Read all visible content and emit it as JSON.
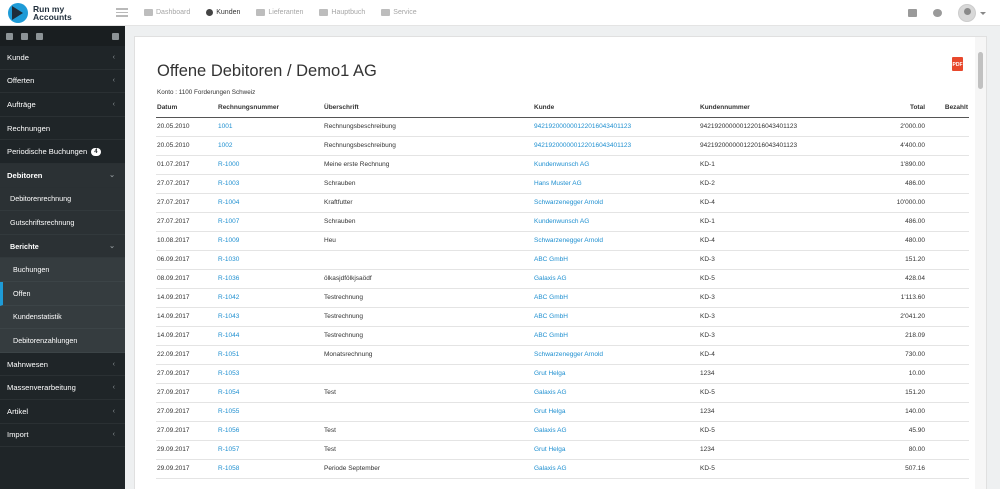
{
  "app": {
    "logo_line1": "Run my",
    "logo_line2": "Accounts"
  },
  "nav": [
    {
      "label": "Dashboard",
      "icon": "dashboard-icon",
      "active": false
    },
    {
      "label": "Kunden",
      "icon": "users-icon",
      "active": true
    },
    {
      "label": "Lieferanten",
      "icon": "truck-icon",
      "active": false
    },
    {
      "label": "Hauptbuch",
      "icon": "book-icon",
      "active": false
    },
    {
      "label": "Service",
      "icon": "service-icon",
      "active": false
    }
  ],
  "sidebar": {
    "items": [
      {
        "label": "Kunde",
        "chevron": "‹"
      },
      {
        "label": "Offerten",
        "chevron": "‹"
      },
      {
        "label": "Aufträge",
        "chevron": "‹"
      },
      {
        "label": "Rechnungen",
        "chevron": ""
      },
      {
        "label": "Periodische Buchungen",
        "chevron": "",
        "badge": "4"
      },
      {
        "label": "Debitoren",
        "chevron": "⌄"
      }
    ],
    "debitoren_sub": [
      {
        "label": "Debitorenrechnung"
      },
      {
        "label": "Gutschriftsrechnung"
      },
      {
        "label": "Berichte",
        "chevron": "⌄"
      }
    ],
    "berichte_sub": [
      {
        "label": "Buchungen"
      },
      {
        "label": "Offen"
      },
      {
        "label": "Kundenstatistik"
      },
      {
        "label": "Debitorenzahlungen"
      }
    ],
    "bottom": [
      {
        "label": "Mahnwesen",
        "chevron": "‹"
      },
      {
        "label": "Massenverarbeitung",
        "chevron": "‹"
      },
      {
        "label": "Artikel",
        "chevron": "‹"
      },
      {
        "label": "Import",
        "chevron": "‹"
      }
    ]
  },
  "report": {
    "title": "Offene Debitoren / Demo1 AG",
    "konto": "Konto : 1100 Forderungen Schweiz",
    "pdf_label": "PDF",
    "columns": [
      "Datum",
      "Rechnungsnummer",
      "Überschrift",
      "Kunde",
      "Kundennummer",
      "Total",
      "Bezahlt"
    ],
    "rows": [
      [
        "20.05.2010",
        "1001",
        "Rechnungsbeschreibung",
        "94219200000012201604340​1123",
        "942192000000122016043401123",
        "2'000.00",
        ""
      ],
      [
        "20.05.2010",
        "1002",
        "Rechnungsbeschreibung",
        "942192000000122016043401123",
        "942192000000122016043401123",
        "4'400.00",
        ""
      ],
      [
        "01.07.2017",
        "R-1000",
        "Meine erste Rechnung",
        "Kundenwunsch AG",
        "KD-1",
        "1'890.00",
        ""
      ],
      [
        "27.07.2017",
        "R-1003",
        "Schrauben",
        "Hans Muster AG",
        "KD-2",
        "486.00",
        ""
      ],
      [
        "27.07.2017",
        "R-1004",
        "Kraftfutter",
        "Schwarzenegger Arnold",
        "KD-4",
        "10'000.00",
        ""
      ],
      [
        "27.07.2017",
        "R-1007",
        "Schrauben",
        "Kundenwunsch AG",
        "KD-1",
        "486.00",
        ""
      ],
      [
        "10.08.2017",
        "R-1009",
        "Heu",
        "Schwarzenegger Arnold",
        "KD-4",
        "480.00",
        ""
      ],
      [
        "06.09.2017",
        "R-1030",
        "",
        "ABC GmbH",
        "KD-3",
        "151.20",
        ""
      ],
      [
        "08.09.2017",
        "R-1036",
        "ölkasjdfölkjsaödf",
        "Galaxis AG",
        "KD-5",
        "428.04",
        ""
      ],
      [
        "14.09.2017",
        "R-1042",
        "Testrechnung",
        "ABC GmbH",
        "KD-3",
        "1'113.60",
        ""
      ],
      [
        "14.09.2017",
        "R-1043",
        "Testrechnung",
        "ABC GmbH",
        "KD-3",
        "2'041.20",
        ""
      ],
      [
        "14.09.2017",
        "R-1044",
        "Testrechnung",
        "ABC GmbH",
        "KD-3",
        "218.09",
        ""
      ],
      [
        "22.09.2017",
        "R-1051",
        "Monatsrechnung",
        "Schwarzenegger Arnold",
        "KD-4",
        "730.00",
        ""
      ],
      [
        "27.09.2017",
        "R-1053",
        "",
        "Grut Helga",
        "1234",
        "10.00",
        ""
      ],
      [
        "27.09.2017",
        "R-1054",
        "Test",
        "Galaxis AG",
        "KD-5",
        "151.20",
        ""
      ],
      [
        "27.09.2017",
        "R-1055",
        "",
        "Grut Helga",
        "1234",
        "140.00",
        ""
      ],
      [
        "27.09.2017",
        "R-1056",
        "Test",
        "Galaxis AG",
        "KD-5",
        "45.90",
        ""
      ],
      [
        "29.09.2017",
        "R-1057",
        "Test",
        "Grut Helga",
        "1234",
        "80.00",
        ""
      ],
      [
        "29.09.2017",
        "R-1058",
        "Periode September",
        "Galaxis AG",
        "KD-5",
        "507.16",
        ""
      ]
    ]
  }
}
